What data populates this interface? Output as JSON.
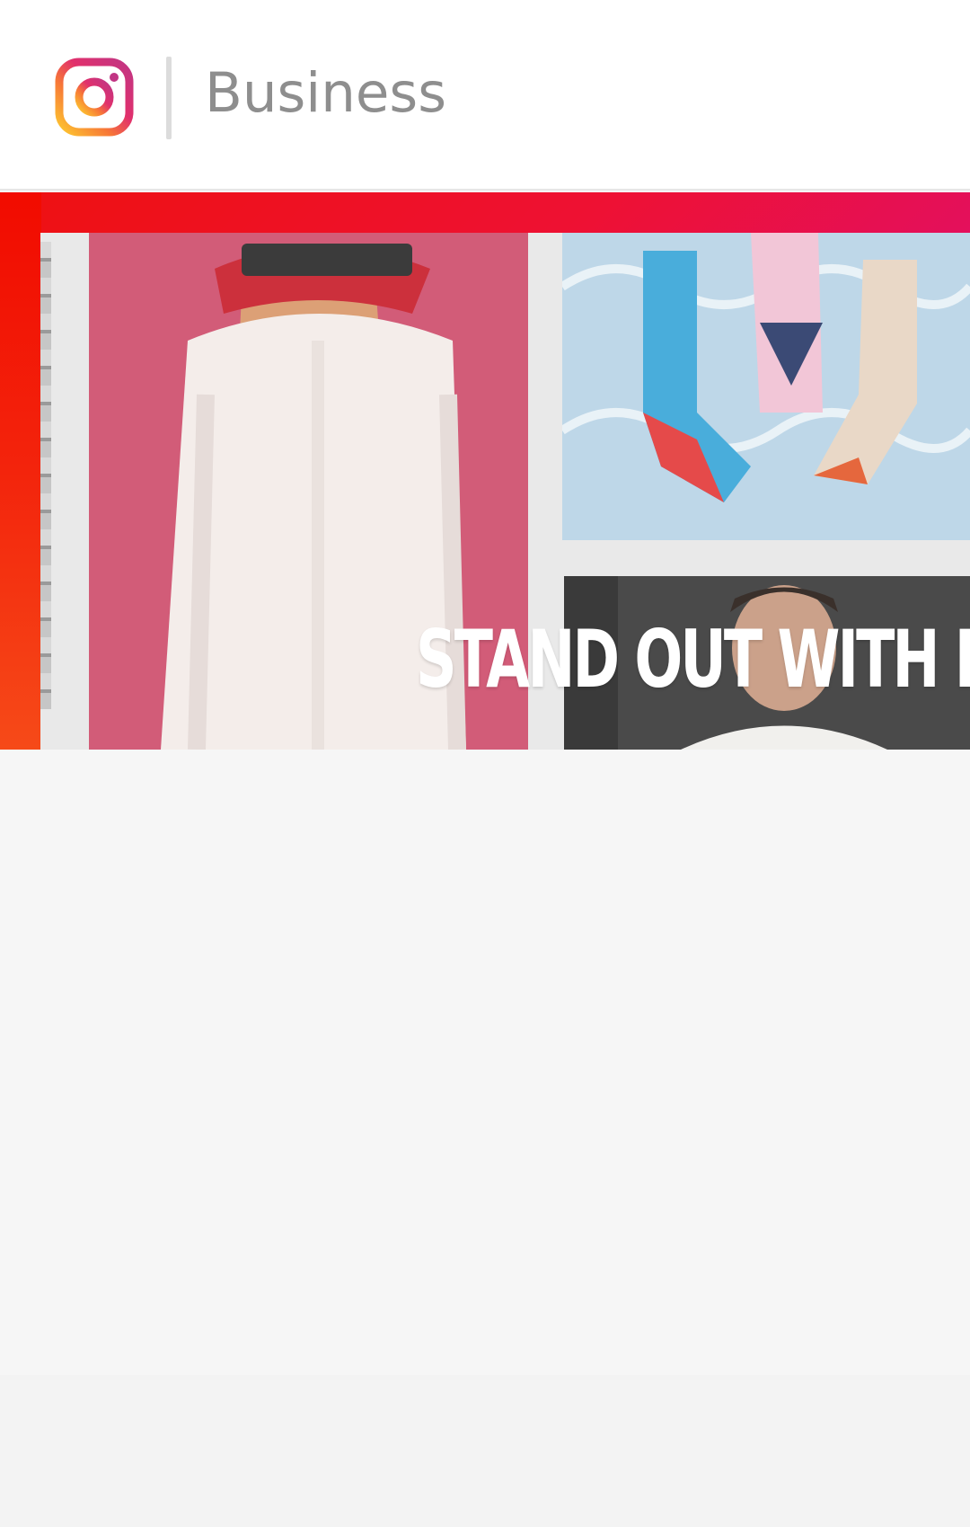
{
  "header": {
    "brand_label": "Business",
    "logo_icon": "instagram-logo-icon"
  },
  "hero": {
    "headline": "STAND OUT WITH INS",
    "images": [
      "fashion-photo",
      "socks-photo",
      "chef-photo"
    ]
  },
  "colors": {
    "brand_gradient_start": "#feda75",
    "brand_gradient_mid": "#d62976",
    "brand_gradient_end": "#962fbf",
    "hero_red": "#ee1133",
    "header_text": "#8e8e8e"
  }
}
